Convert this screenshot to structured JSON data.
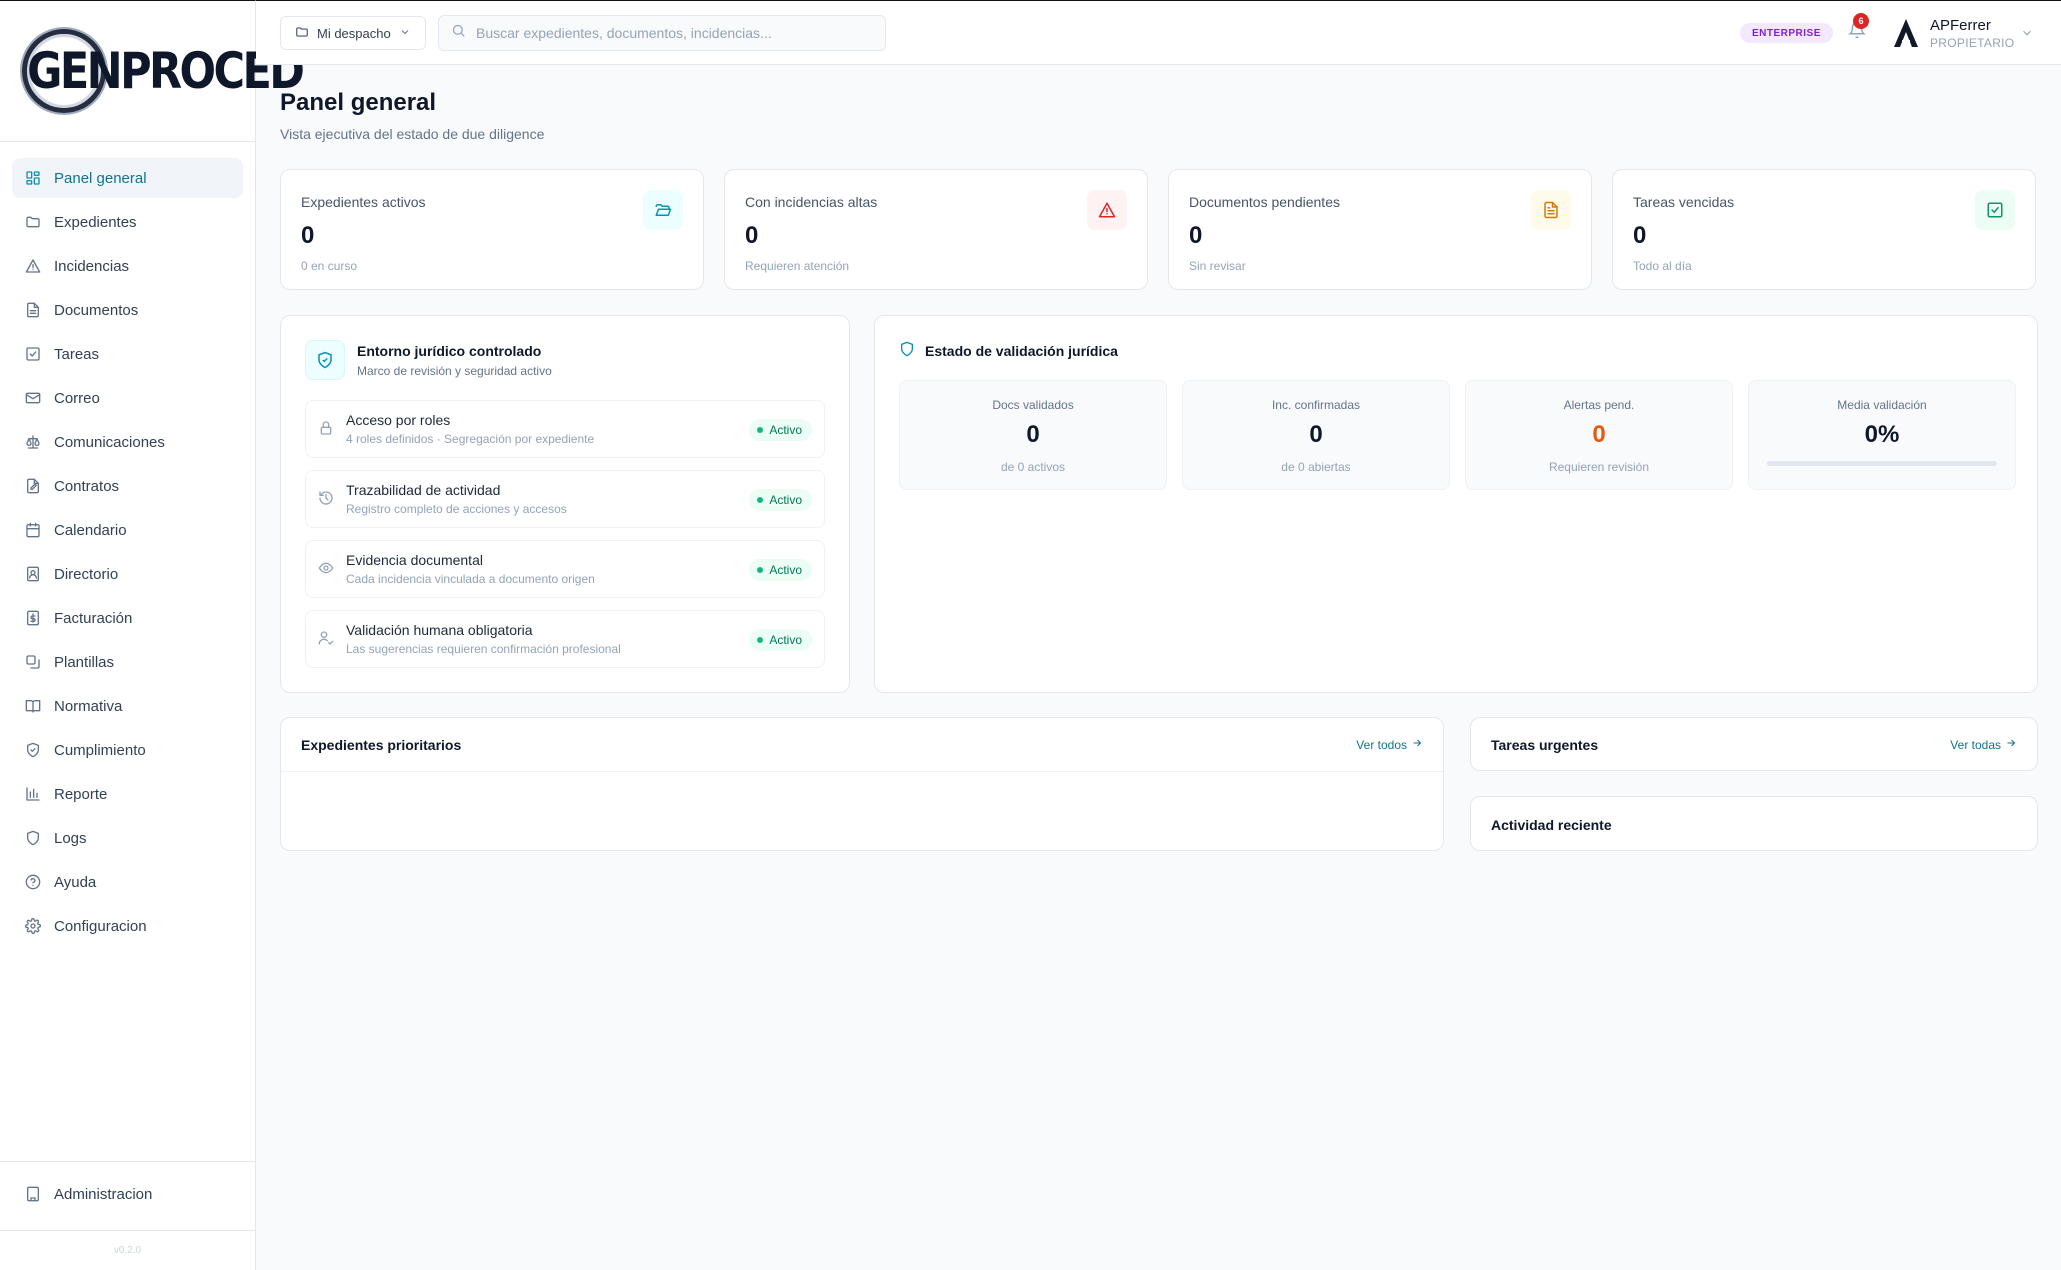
{
  "app": {
    "logo_text": "GENPROCED",
    "version": "v0.2.0"
  },
  "sidebar": {
    "items": [
      {
        "label": "Panel general",
        "icon": "grid-icon",
        "active": true
      },
      {
        "label": "Expedientes",
        "icon": "folder-icon"
      },
      {
        "label": "Incidencias",
        "icon": "warning-icon"
      },
      {
        "label": "Documentos",
        "icon": "document-icon"
      },
      {
        "label": "Tareas",
        "icon": "checkbox-icon"
      },
      {
        "label": "Correo",
        "icon": "mail-icon"
      },
      {
        "label": "Comunicaciones",
        "icon": "scale-icon"
      },
      {
        "label": "Contratos",
        "icon": "contract-icon"
      },
      {
        "label": "Calendario",
        "icon": "calendar-icon"
      },
      {
        "label": "Directorio",
        "icon": "contact-book-icon"
      },
      {
        "label": "Facturación",
        "icon": "invoice-icon"
      },
      {
        "label": "Plantillas",
        "icon": "templates-icon"
      },
      {
        "label": "Normativa",
        "icon": "book-icon"
      },
      {
        "label": "Cumplimiento",
        "icon": "shield-check-icon"
      },
      {
        "label": "Reporte",
        "icon": "bar-chart-icon"
      },
      {
        "label": "Logs",
        "icon": "shield-icon"
      },
      {
        "label": "Ayuda",
        "icon": "help-icon"
      },
      {
        "label": "Configuracion",
        "icon": "gear-icon"
      }
    ],
    "admin_label": "Administracion"
  },
  "header": {
    "workspace_label": "Mi despacho",
    "search_placeholder": "Buscar expedientes, documentos, incidencias...",
    "plan_badge": "ENTERPRISE",
    "notification_count": "6",
    "user_name": "APFerrer",
    "user_role": "PROPIETARIO"
  },
  "page": {
    "title": "Panel general",
    "subtitle": "Vista ejecutiva del estado de due diligence"
  },
  "stats": [
    {
      "label": "Expedientes activos",
      "value": "0",
      "hint": "0 en curso",
      "icon": "folder-open-icon",
      "color": "#0891b2",
      "bg": "#ecfeff"
    },
    {
      "label": "Con incidencias altas",
      "value": "0",
      "hint": "Requieren atención",
      "icon": "alert-triangle-icon",
      "color": "#dc2626",
      "bg": "#fef2f2"
    },
    {
      "label": "Documentos pendientes",
      "value": "0",
      "hint": "Sin revisar",
      "icon": "file-text-icon",
      "color": "#d97706",
      "bg": "#fffbeb"
    },
    {
      "label": "Tareas vencidas",
      "value": "0",
      "hint": "Todo al día",
      "icon": "check-square-icon",
      "color": "#059669",
      "bg": "#ecfdf5"
    }
  ],
  "environment": {
    "title": "Entorno jurídico controlado",
    "subtitle": "Marco de revisión y seguridad activo",
    "controls": [
      {
        "title": "Acceso por roles",
        "desc": "4 roles definidos · Segregación por expediente",
        "status": "Activo",
        "icon": "lock-icon"
      },
      {
        "title": "Trazabilidad de actividad",
        "desc": "Registro completo de acciones y accesos",
        "status": "Activo",
        "icon": "history-icon"
      },
      {
        "title": "Evidencia documental",
        "desc": "Cada incidencia vinculada a documento origen",
        "status": "Activo",
        "icon": "eye-icon"
      },
      {
        "title": "Validación humana obligatoria",
        "desc": "Las sugerencias requieren confirmación profesional",
        "status": "Activo",
        "icon": "user-check-icon"
      }
    ]
  },
  "validation": {
    "title": "Estado de validación jurídica",
    "metrics": [
      {
        "label": "Docs validados",
        "value": "0",
        "hint": "de 0 activos"
      },
      {
        "label": "Inc. confirmadas",
        "value": "0",
        "hint": "de 0 abiertas"
      },
      {
        "label": "Alertas pend.",
        "value": "0",
        "hint": "Requieren revisión",
        "color": "#ea580c"
      },
      {
        "label": "Media validación",
        "value": "0%",
        "progress": 0
      }
    ]
  },
  "priority_cases": {
    "title": "Expedientes prioritarios",
    "link": "Ver todos"
  },
  "urgent_tasks": {
    "title": "Tareas urgentes",
    "link": "Ver todas"
  },
  "recent_activity": {
    "title": "Actividad reciente"
  }
}
